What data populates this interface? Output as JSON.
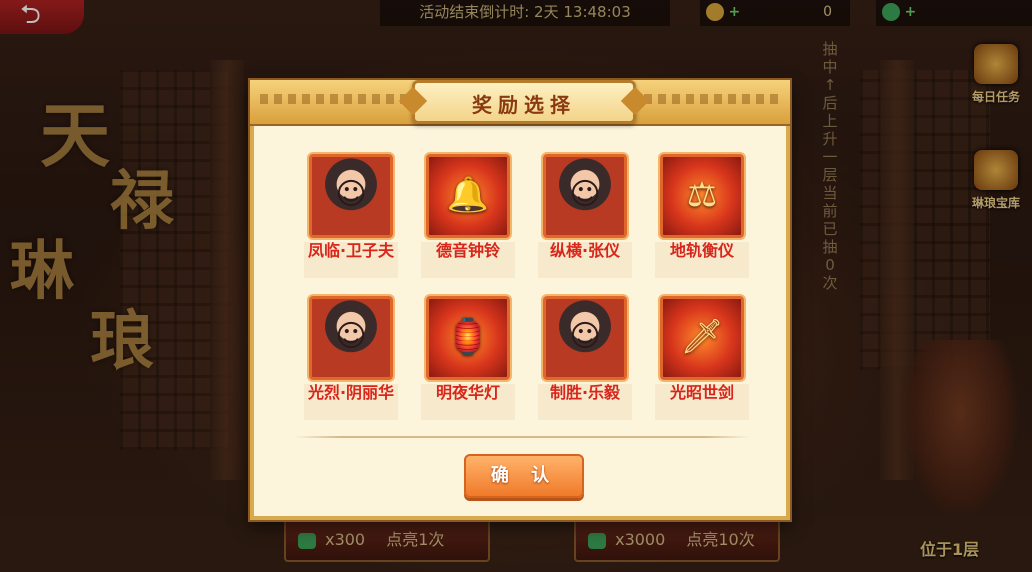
{
  "header": {
    "back_icon": "back-arrow-icon",
    "timer_text": "活动结束倒计时: 2天 13:48:03",
    "resource1_value": "0",
    "resource1_icon": "coin-icon",
    "resource2_icon": "jade-icon"
  },
  "background": {
    "calligraphy": [
      "天",
      "禄",
      "琳",
      "琅"
    ],
    "vertical_note": "抽中↑后上升一层 当前已抽0次"
  },
  "side_buttons": [
    {
      "label": "每日任务",
      "icon": "scroll-icon"
    },
    {
      "label": "琳琅宝库",
      "icon": "treasure-icon"
    }
  ],
  "bottom_buttons": [
    {
      "count": "x300",
      "label": "点亮1次"
    },
    {
      "count": "x3000",
      "label": "点亮10次"
    }
  ],
  "floor_label": "位于1层",
  "modal": {
    "title": "奖励选择",
    "confirm_label": "确 认",
    "rewards": [
      {
        "name": "凤临·卫子夫",
        "kind": "hero",
        "icon": "hero-portrait-icon"
      },
      {
        "name": "德音钟铃",
        "kind": "item",
        "icon": "bell-staff-icon"
      },
      {
        "name": "纵横·张仪",
        "kind": "hero",
        "icon": "hero-portrait-icon"
      },
      {
        "name": "地轨衡仪",
        "kind": "item",
        "icon": "instrument-icon"
      },
      {
        "name": "光烈·阴丽华",
        "kind": "hero",
        "icon": "hero-portrait-icon"
      },
      {
        "name": "明夜华灯",
        "kind": "item",
        "icon": "lantern-icon"
      },
      {
        "name": "制胜·乐毅",
        "kind": "hero",
        "icon": "hero-portrait-icon"
      },
      {
        "name": "光昭世剑",
        "kind": "item",
        "icon": "sword-icon"
      }
    ]
  }
}
